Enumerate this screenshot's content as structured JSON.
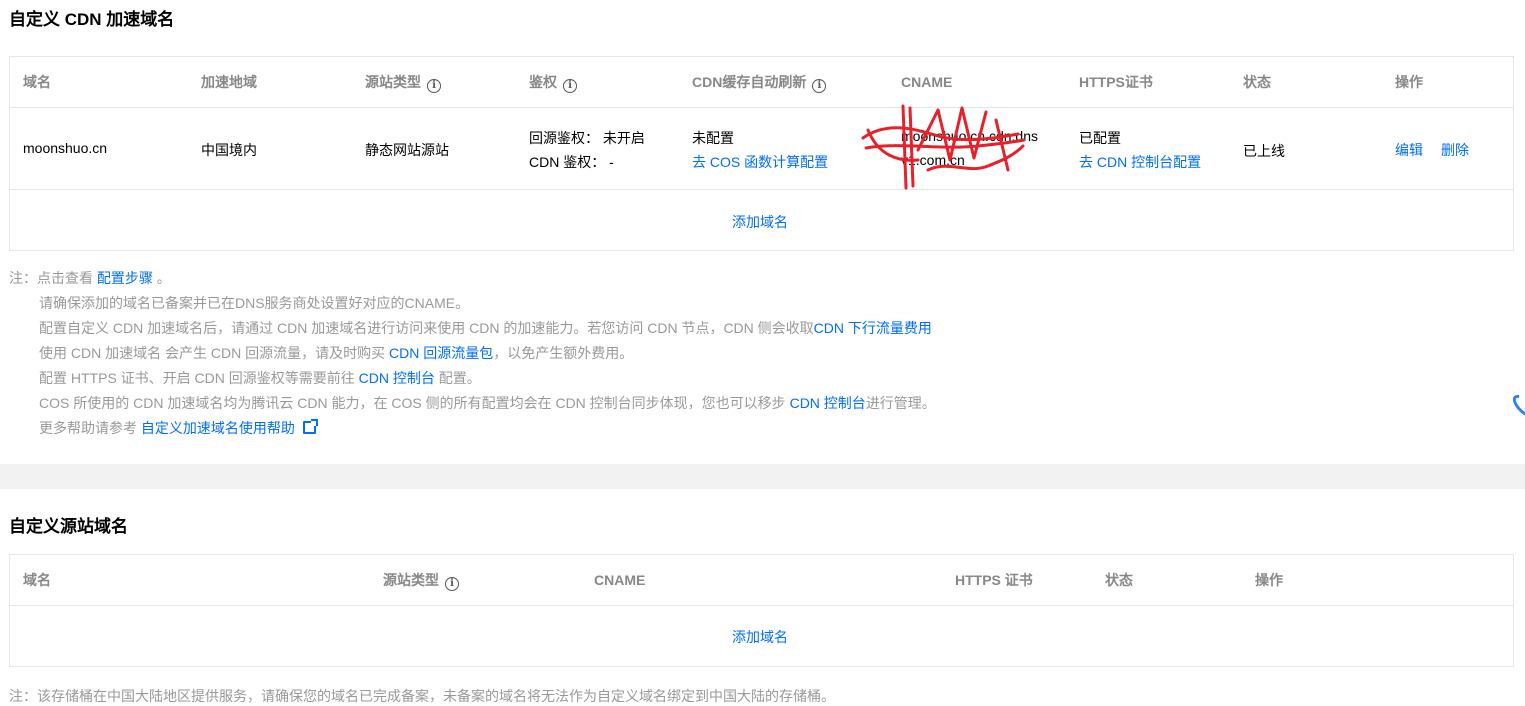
{
  "cdn_section": {
    "title": "自定义 CDN 加速域名",
    "headers": [
      "域名",
      "加速地域",
      "源站类型",
      "鉴权",
      "CDN缓存自动刷新",
      "CNAME",
      "HTTPS证书",
      "状态",
      "操作"
    ],
    "row": {
      "domain": "moonshuo.cn",
      "region": "中国境内",
      "origin_type": "静态网站源站",
      "auth_origin": "回源鉴权：  未开启",
      "auth_cdn": "CDN 鉴权：  -",
      "refresh_status": "未配置",
      "refresh_link": "去 COS 函数计算配置",
      "cname_line1": "moonshuo.cn.cdn.dns",
      "cname_line2": "v1.com.cn",
      "https_status": "已配置",
      "https_link": "去 CDN 控制台配置",
      "status": "已上线",
      "action_edit": "编辑",
      "action_delete": "删除"
    },
    "add_domain": "添加域名"
  },
  "notes": {
    "prefix": "注：点击查看 ",
    "steps_link": "配置步骤",
    "steps_suffix": " 。",
    "line2": "请确保添加的域名已备案并已在DNS服务商处设置好对应的CNAME。",
    "line3_text": "配置自定义 CDN 加速域名后，请通过 CDN 加速域名进行访问来使用 CDN 的加速能力。若您访问 CDN 节点，CDN 侧会收取",
    "line3_link": "CDN 下行流量费用",
    "line4_text": "使用 CDN 加速域名 会产生 CDN 回源流量，请及时购买 ",
    "line4_link": "CDN 回源流量包",
    "line4_suffix": "，以免产生额外费用。",
    "line5_text": "配置 HTTPS 证书、开启 CDN 回源鉴权等需要前往 ",
    "line5_link": "CDN 控制台",
    "line5_suffix": " 配置。",
    "line6_text": "COS 所使用的 CDN 加速域名均为腾讯云 CDN 能力，在 COS 侧的所有配置均会在 CDN 控制台同步体现，您也可以移步 ",
    "line6_link": "CDN 控制台",
    "line6_suffix": "进行管理。",
    "line7_text": "更多帮助请参考 ",
    "line7_link": "自定义加速域名使用帮助"
  },
  "origin_section": {
    "title": "自定义源站域名",
    "headers": [
      "域名",
      "源站类型",
      "CNAME",
      "HTTPS 证书",
      "状态",
      "操作"
    ],
    "add_domain": "添加域名",
    "footer_note": "注：该存储桶在中国大陆地区提供服务，请确保您的域名已完成备案，未备案的域名将无法作为自定义域名绑定到中国大陆的存储桶。"
  },
  "icons": {
    "info": "info-circle-icon",
    "external": "external-link-icon"
  },
  "colors": {
    "link": "#006eff",
    "header_text": "#888888",
    "note_text": "#999999",
    "border": "#e5e5e5",
    "redaction": "#e8202a"
  }
}
